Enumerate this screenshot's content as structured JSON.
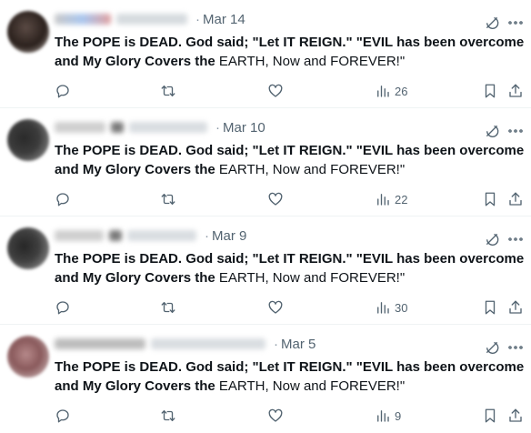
{
  "colors": {
    "text": "#0f1419",
    "muted": "#536471",
    "divider": "#eff3f4"
  },
  "tweets": [
    {
      "date": "Mar 14",
      "text_bold_1": "The POPE is DEAD. God said; \"Let IT REIGN.\" \"EVIL has been overcome and My Glory Covers the ",
      "text_plain": "EARTH, Now and FOREVER!\"",
      "views": "26",
      "icons": [
        "reply-icon",
        "retweet-icon",
        "like-icon",
        "views-icon",
        "bookmark-icon",
        "share-icon"
      ]
    },
    {
      "date": "Mar 10",
      "text_bold_1": "The POPE is DEAD. God said; \"Let IT REIGN.\" \"EVIL has been overcome and My Glory Covers the ",
      "text_plain": "EARTH, Now and FOREVER!\"",
      "views": "22"
    },
    {
      "date": "Mar 9",
      "text_bold_1": "The POPE is DEAD. God said; \"Let IT REIGN.\" \"EVIL has been overcome and My Glory Covers the ",
      "text_plain": "EARTH, Now and FOREVER!\"",
      "views": "30"
    },
    {
      "date": "Mar 5",
      "text_bold_1": "The POPE is DEAD. God said; \"Let IT REIGN.\" \"EVIL has been overcome and My Glory Covers the ",
      "text_plain": "EARTH, Now and FOREVER!\"",
      "views": "9"
    }
  ]
}
